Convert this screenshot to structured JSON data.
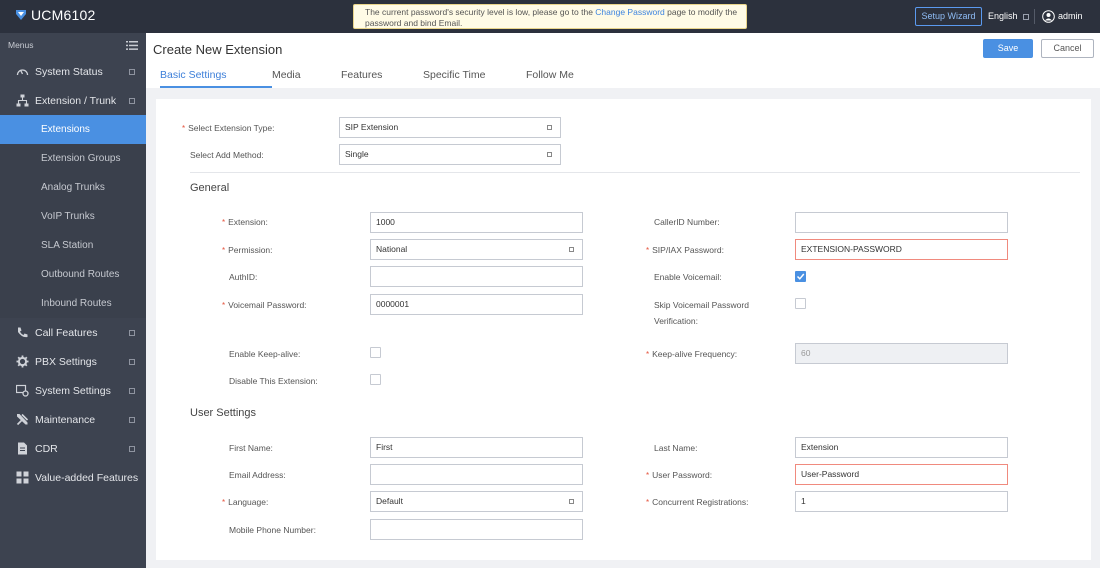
{
  "topbar": {
    "brand": "UCM6102",
    "notice_text_1": "The current password's security level is low, please go to the ",
    "notice_link": "Change Password",
    "notice_text_2": " page to modify the password and bind Email.",
    "setup_wizard": "Setup Wizard",
    "language": "English",
    "user": "admin"
  },
  "sidebar": {
    "menus_label": "Menus",
    "system_status": "System Status",
    "extension_trunk": "Extension / Trunk",
    "sub_items": [
      "Extensions",
      "Extension Groups",
      "Analog Trunks",
      "VoIP Trunks",
      "SLA Station",
      "Outbound Routes",
      "Inbound Routes"
    ],
    "call_features": "Call Features",
    "pbx_settings": "PBX Settings",
    "system_settings": "System Settings",
    "maintenance": "Maintenance",
    "cdr": "CDR",
    "value_added": "Value-added Features"
  },
  "header": {
    "title": "Create New Extension",
    "save": "Save",
    "cancel": "Cancel",
    "tabs": [
      "Basic Settings",
      "Media",
      "Features",
      "Specific Time",
      "Follow Me"
    ]
  },
  "form": {
    "ext_type_label": "Select Extension Type:",
    "ext_type_value": "SIP Extension",
    "add_method_label": "Select Add Method:",
    "add_method_value": "Single",
    "general_title": "General",
    "extension_label": "Extension:",
    "extension_value": "1000",
    "callerid_label": "CallerID Number:",
    "callerid_value": "",
    "permission_label": "Permission:",
    "permission_value": "National",
    "sip_password_label": "SIP/IAX Password:",
    "sip_password_value": "EXTENSION-PASSWORD",
    "authid_label": "AuthID:",
    "authid_value": "",
    "enable_voicemail_label": "Enable Voicemail:",
    "enable_voicemail": true,
    "voicemail_password_label": "Voicemail Password:",
    "voicemail_password_value": "0000001",
    "skip_vm_label_1": "Skip Voicemail Password",
    "skip_vm_label_2": "Verification:",
    "skip_vm": false,
    "keepalive_label": "Enable Keep-alive:",
    "keepalive": false,
    "keepalive_freq_label": "Keep-alive Frequency:",
    "keepalive_freq_value": "60",
    "disable_ext_label": "Disable This Extension:",
    "disable_ext": false,
    "user_settings_title": "User Settings",
    "first_name_label": "First Name:",
    "first_name_value": "First",
    "last_name_label": "Last Name:",
    "last_name_value": "Extension",
    "email_label": "Email Address:",
    "email_value": "",
    "user_password_label": "User Password:",
    "user_password_value": "User-Password",
    "language_label": "Language:",
    "language_value": "Default",
    "concurrent_label": "Concurrent Registrations:",
    "concurrent_value": "1",
    "mobile_label": "Mobile Phone Number:",
    "mobile_value": ""
  },
  "colors": {
    "accent": "#4a90e2",
    "sidebar_bg": "#3d4350",
    "topbar_bg": "#2c313d",
    "required": "#e5533d",
    "error_border": "#f08a7e"
  }
}
